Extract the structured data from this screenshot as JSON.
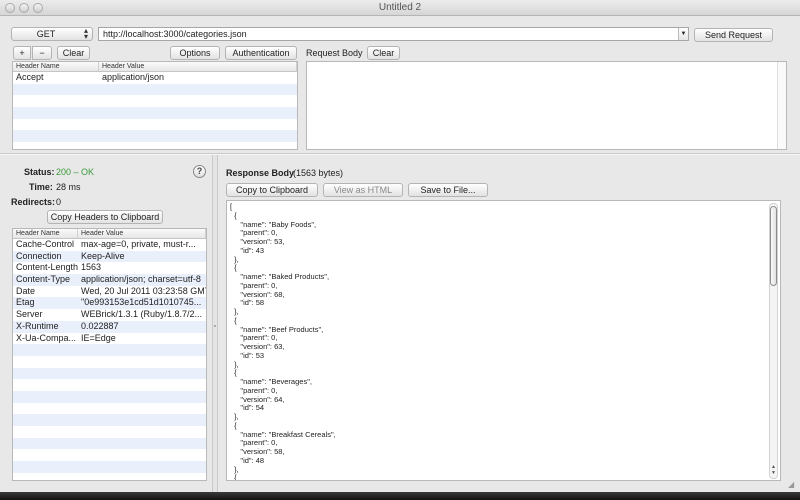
{
  "window": {
    "title": "Untitled 2"
  },
  "request": {
    "method": "GET",
    "url": "http://localhost:3000/categories.json",
    "send_label": "Send Request",
    "add_label": "+",
    "remove_label": "−",
    "clear_headers_label": "Clear",
    "options_label": "Options",
    "authentication_label": "Authentication",
    "request_body_label": "Request Body",
    "clear_body_label": "Clear",
    "body": "",
    "headers_table": {
      "columns": [
        "Header Name",
        "Header Value"
      ],
      "rows": [
        {
          "name": "Accept",
          "value": "application/json"
        }
      ]
    }
  },
  "response": {
    "status_label": "Status:",
    "status_value": "200 – OK",
    "status_color": "#3a9a3a",
    "time_label": "Time:",
    "time_value": "28 ms",
    "redirects_label": "Redirects:",
    "redirects_value": "0",
    "help_label": "?",
    "copy_headers_label": "Copy Headers to Clipboard",
    "headers_table": {
      "columns": [
        "Header Name",
        "Header Value"
      ],
      "rows": [
        {
          "name": "Cache-Control",
          "value": "max-age=0, private, must-r..."
        },
        {
          "name": "Connection",
          "value": "Keep-Alive"
        },
        {
          "name": "Content-Length",
          "value": "1563"
        },
        {
          "name": "Content-Type",
          "value": "application/json; charset=utf-8"
        },
        {
          "name": "Date",
          "value": "Wed, 20 Jul 2011 03:23:58 GMT"
        },
        {
          "name": "Etag",
          "value": "\"0e993153e1cd51d1010745..."
        },
        {
          "name": "Server",
          "value": "WEBrick/1.3.1 (Ruby/1.8.7/2..."
        },
        {
          "name": "X-Runtime",
          "value": "0.022887"
        },
        {
          "name": "X-Ua-Compa...",
          "value": "IE=Edge"
        }
      ]
    },
    "body_label": "Response Body",
    "body_size": "(1563 bytes)",
    "copy_clipboard_label": "Copy to Clipboard",
    "view_html_label": "View as HTML",
    "save_file_label": "Save to File...",
    "body_text": "[\n  {\n     \"name\": \"Baby Foods\",\n     \"parent\": 0,\n     \"version\": 53,\n     \"id\": 43\n  },\n  {\n     \"name\": \"Baked Products\",\n     \"parent\": 0,\n     \"version\": 68,\n     \"id\": 58\n  },\n  {\n     \"name\": \"Beef Products\",\n     \"parent\": 0,\n     \"version\": 63,\n     \"id\": 53\n  },\n  {\n     \"name\": \"Beverages\",\n     \"parent\": 0,\n     \"version\": 64,\n     \"id\": 54\n  },\n  {\n     \"name\": \"Breakfast Cereals\",\n     \"parent\": 0,\n     \"version\": 58,\n     \"id\": 48\n  },\n  {\n     \"name\": \"Cereal Grains and Pasta\",",
    "scroll_position": 0
  }
}
